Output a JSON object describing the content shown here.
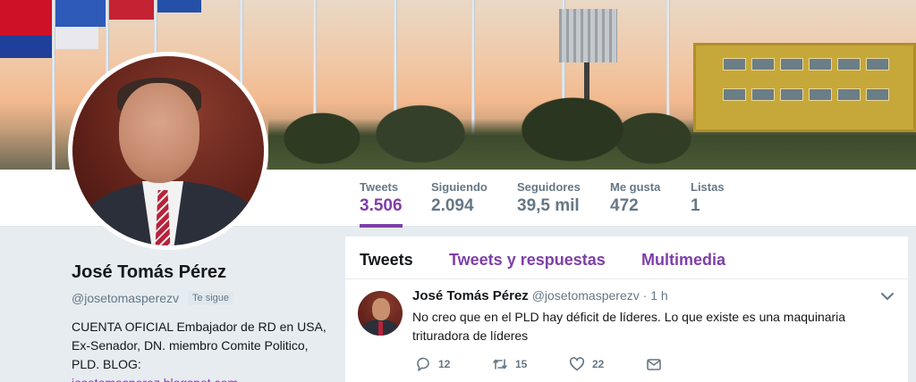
{
  "profile_nav": {
    "stats": [
      {
        "label": "Tweets",
        "value": "3.506",
        "active": true
      },
      {
        "label": "Siguiendo",
        "value": "2.094"
      },
      {
        "label": "Seguidores",
        "value": "39,5 mil"
      },
      {
        "label": "Me gusta",
        "value": "472"
      },
      {
        "label": "Listas",
        "value": "1"
      }
    ]
  },
  "profile": {
    "name": "José Tomás Pérez",
    "handle": "@josetomasperezv",
    "follows_you": "Te sigue",
    "bio": "CUENTA OFICIAL Embajador de RD en USA, Ex-Senador, DN. miembro Comite Politico, PLD. BLOG:",
    "bio_link": "josetomasperez.blogspot.com"
  },
  "timeline": {
    "tabs": [
      "Tweets",
      "Tweets y respuestas",
      "Multimedia"
    ],
    "tweet": {
      "name": "José Tomás Pérez",
      "handle": "@josetomasperezv",
      "dot": "·",
      "time": "1 h",
      "text": "No creo que en el PLD hay déficit de líderes. Lo que existe es una maquinaria trituradora  de líderes",
      "replies": "12",
      "retweets": "15",
      "likes": "22"
    }
  },
  "colors": {
    "accent": "#7e3fa8",
    "muted": "#657786",
    "background": "#e6ecf0"
  },
  "icons": [
    "reply-icon",
    "retweet-icon",
    "like-icon",
    "message-icon",
    "caret-down-icon"
  ]
}
